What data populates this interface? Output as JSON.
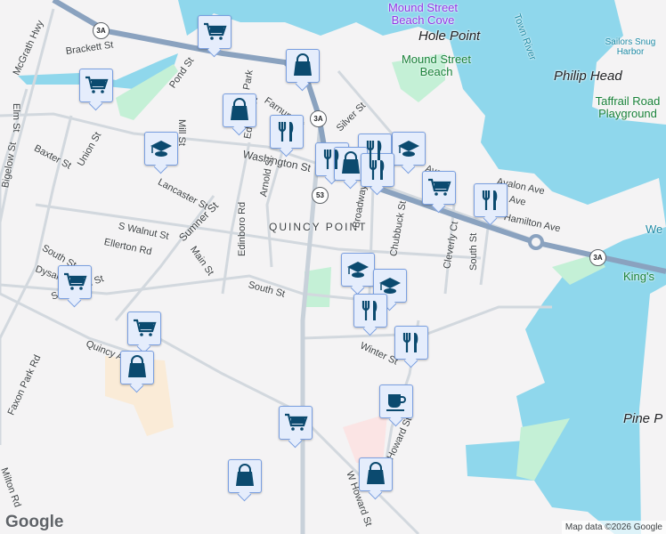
{
  "map": {
    "places": [
      "Hole Point",
      "Philip Head",
      "Pine P"
    ],
    "neighborhood": "QUINCY POINT",
    "parks": [
      "Mound Street Beach",
      "Taffrail Road Playground",
      "King's"
    ],
    "poi": "Mound Street Beach Cove",
    "water": [
      "Town River",
      "Sailors Snug Harbor",
      "We"
    ],
    "streets": [
      "McGrath Hwy",
      "Brackett St",
      "Elm St",
      "Pond St",
      "Mill St",
      "Park",
      "Farnum St",
      "Edison St",
      "Silver St",
      "Washington St",
      "Baxter St",
      "Union St",
      "Lancaster St",
      "Sumner St",
      "Arnold St",
      "Edinboro Rd",
      "S Walnut St",
      "Ellerton Rd",
      "Main St",
      "South St",
      "South St",
      "Dysart St",
      "Scammell St",
      "Broadway",
      "Chubbuck St",
      "Cleverly Ct",
      "South St",
      "Avalon Ave",
      "Ave",
      "Hamilton Ave",
      "Winter St",
      "Howard St",
      "W Howard St",
      "Quincy Ave",
      "Faxon Park Rd",
      "Milton Rd",
      "Bigelow St",
      "Ave"
    ],
    "shields": [
      "3A",
      "3A",
      "53",
      "3A"
    ],
    "attribution": "Map data ©2026 Google",
    "logo": "Google"
  },
  "markers": [
    {
      "type": "cart-icon"
    },
    {
      "type": "cart-icon"
    },
    {
      "type": "bag-icon"
    },
    {
      "type": "bag-icon"
    },
    {
      "type": "graduation-cap-icon"
    },
    {
      "type": "fork-knife-icon"
    },
    {
      "type": "fork-knife-icon"
    },
    {
      "type": "bag-icon"
    },
    {
      "type": "fork-knife-icon"
    },
    {
      "type": "graduation-cap-icon"
    },
    {
      "type": "fork-knife-icon"
    },
    {
      "type": "cart-icon"
    },
    {
      "type": "fork-knife-icon"
    },
    {
      "type": "graduation-cap-icon"
    },
    {
      "type": "graduation-cap-icon"
    },
    {
      "type": "fork-knife-icon"
    },
    {
      "type": "fork-knife-icon"
    },
    {
      "type": "cart-icon"
    },
    {
      "type": "cart-icon"
    },
    {
      "type": "bag-icon"
    },
    {
      "type": "cart-icon"
    },
    {
      "type": "bag-icon"
    },
    {
      "type": "coffee-icon"
    },
    {
      "type": "bag-icon"
    }
  ],
  "colors": {
    "water": "#8fd7ec",
    "park": "#c4f0d6",
    "highway": "#8aa2bf",
    "marker": "#0b4a6f"
  }
}
